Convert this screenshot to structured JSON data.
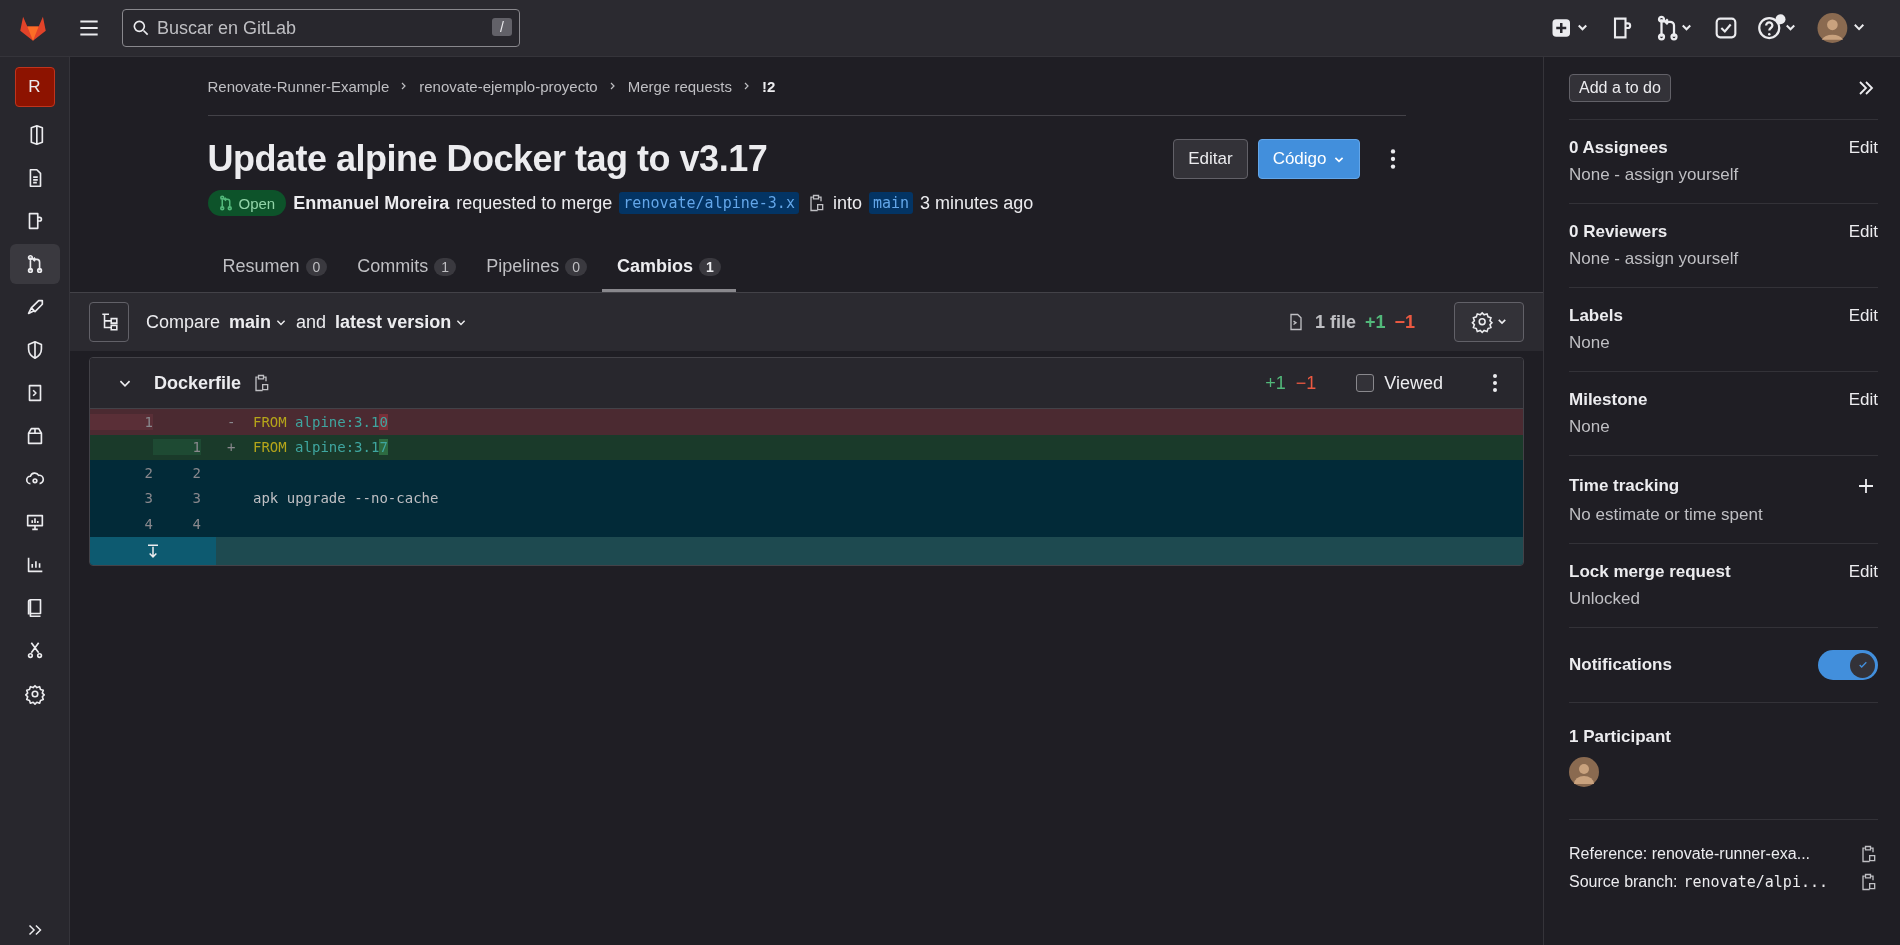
{
  "topbar": {
    "search": {
      "placeholder": "Buscar en GitLab",
      "shortcut": "/"
    }
  },
  "nav": {
    "project_initial": "R",
    "items": [
      {
        "kind": "overview",
        "selected": false
      },
      {
        "kind": "issues",
        "selected": false
      },
      {
        "kind": "snippets",
        "selected": false
      },
      {
        "kind": "merge",
        "selected": true
      },
      {
        "kind": "deploy",
        "selected": false
      },
      {
        "kind": "secure",
        "selected": false
      },
      {
        "kind": "operate",
        "selected": false
      },
      {
        "kind": "package",
        "selected": false
      },
      {
        "kind": "cloud",
        "selected": false
      },
      {
        "kind": "monitor",
        "selected": false
      },
      {
        "kind": "analytics",
        "selected": false
      },
      {
        "kind": "wiki",
        "selected": false
      },
      {
        "kind": "snip",
        "selected": false
      },
      {
        "kind": "settings",
        "selected": false
      }
    ]
  },
  "breadcrumb": [
    "Renovate-Runner-Example",
    "renovate-ejemplo-proyecto",
    "Merge requests",
    "!2"
  ],
  "title": "Update alpine Docker tag to v3.17",
  "actions": {
    "edit": "Editar",
    "code": "Código"
  },
  "meta": {
    "status": "Open",
    "author": "Enmanuel Moreira",
    "verb": "requested to merge",
    "source": "renovate/alpine-3.x",
    "into": "into",
    "target": "main",
    "time": "3 minutes ago"
  },
  "tabs": [
    {
      "label": "Resumen",
      "count": "0",
      "selected": false
    },
    {
      "label": "Commits",
      "count": "1",
      "selected": false
    },
    {
      "label": "Pipelines",
      "count": "0",
      "selected": false
    },
    {
      "label": "Cambios",
      "count": "1",
      "selected": true
    }
  ],
  "compare": {
    "label": "Compare",
    "base": "main",
    "and": "and",
    "head": "latest version",
    "files": "1 file",
    "added": "+1",
    "removed": "−1"
  },
  "file": {
    "name": "Dockerfile",
    "added": "+1",
    "removed": "−1",
    "viewed_label": "Viewed",
    "viewed": false,
    "lines": [
      {
        "kind": "removed",
        "old": "1",
        "sign": "-",
        "tokens": [
          {
            "text": "FROM",
            "kind": "keyword"
          },
          {
            "text": "alpine:3.1",
            "kind": "string"
          },
          {
            "text": "0",
            "kind": "changed"
          }
        ]
      },
      {
        "kind": "added",
        "new": "1",
        "sign": "+",
        "tokens": [
          {
            "text": "FROM",
            "kind": "keyword"
          },
          {
            "text": "alpine:3.1",
            "kind": "string"
          },
          {
            "text": "7",
            "kind": "changed"
          }
        ]
      },
      {
        "kind": "context",
        "old": "2",
        "new": "2"
      },
      {
        "kind": "context",
        "old": "3",
        "new": "3",
        "tokens": [
          {
            "text": "apk upgrade --no-cache",
            "kind": "plain"
          }
        ]
      },
      {
        "kind": "context",
        "old": "4",
        "new": "4"
      }
    ]
  },
  "sidebar": {
    "todo": "Add a to do",
    "sections": [
      {
        "kind": "edit",
        "title": "0 Assignees",
        "value": "None - assign yourself",
        "action": "Edit"
      },
      {
        "kind": "edit",
        "title": "0 Reviewers",
        "value": "None - assign yourself",
        "action": "Edit"
      },
      {
        "kind": "edit",
        "title": "Labels",
        "value": "None",
        "action": "Edit"
      },
      {
        "kind": "edit",
        "title": "Milestone",
        "value": "None",
        "action": "Edit"
      },
      {
        "kind": "add",
        "title": "Time tracking",
        "value": "No estimate or time spent"
      },
      {
        "kind": "edit",
        "title": "Lock merge request",
        "value": "Unlocked",
        "action": "Edit"
      }
    ],
    "notifications": {
      "label": "Notifications",
      "on": true
    },
    "participants": "1 Participant",
    "reference": {
      "label": "Reference:",
      "value": "renovate-runner-exa..."
    },
    "source_branch": {
      "label": "Source branch:",
      "value": "renovate/alpi..."
    }
  }
}
